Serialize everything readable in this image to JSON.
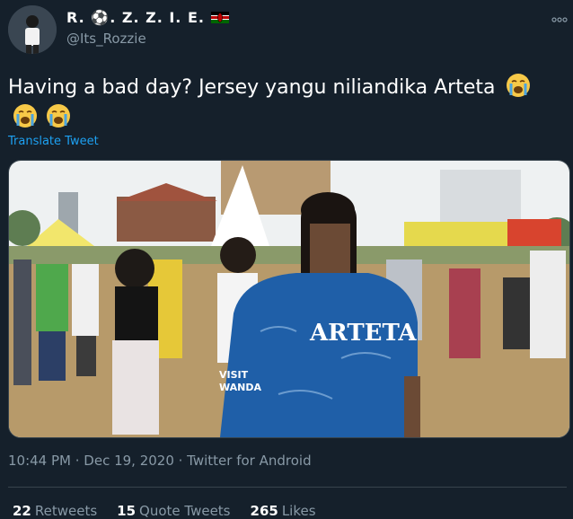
{
  "user": {
    "display_name": "R. ⚽. Z. Z. I. E.",
    "handle": "@Its_Rozzie"
  },
  "tweet": {
    "text": "Having a bad day? Jersey yangu niliandika Arteta",
    "translate_label": "Translate Tweet",
    "timestamp": "10:44 PM · Dec 19, 2020 · Twitter for Android"
  },
  "image": {
    "jersey_name": "ARTETA",
    "sleeve_text_1": "VISIT",
    "sleeve_text_2": "WANDA"
  },
  "stats": {
    "retweets_count": "22",
    "retweets_label": "Retweets",
    "quotes_count": "15",
    "quotes_label": "Quote Tweets",
    "likes_count": "265",
    "likes_label": "Likes"
  },
  "icons": {
    "more": "more-horizontal-icon",
    "flag": "kenya-flag-icon",
    "emoji": "loudly-crying-face-emoji"
  },
  "colors": {
    "background": "#15202b",
    "link": "#1da1f2",
    "secondary_text": "#8899a6",
    "jersey": "#1f5fa8"
  }
}
